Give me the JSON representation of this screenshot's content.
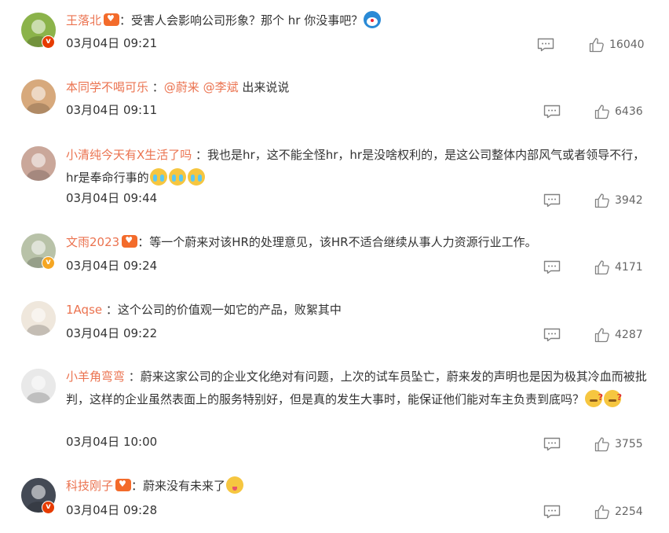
{
  "colors": {
    "username": "#eb7350",
    "text": "#333333",
    "meta": "#666666"
  },
  "comments": [
    {
      "username": "王落北",
      "badge": "red",
      "vip": true,
      "text": "：受害人会影响公司形象？那个 hr 你没事吧？",
      "emoji": [
        "doraemon"
      ],
      "time": "03月04日 09:21",
      "likes": "16040"
    },
    {
      "username": "本同学不喝可乐",
      "badge": "",
      "vip": false,
      "sep": " ：",
      "mentions": [
        "@蔚来",
        "@李斌"
      ],
      "text": " 出来说说",
      "time": "03月04日 09:11",
      "likes": "6436"
    },
    {
      "username": "小清纯今天有X生活了吗",
      "badge": "",
      "vip": false,
      "text": " ：我也是hr，这不能全怪hr，hr是没啥权利的，是这公司整体内部风气或者领导不行，hr是奉命行事的",
      "emoji": [
        "cry",
        "cry",
        "cry"
      ],
      "time": "03月04日 09:44",
      "likes": "3942"
    },
    {
      "username": "文雨2023",
      "badge": "gold",
      "vip": true,
      "text": "：等一个蔚来对该HR的处理意见，该HR不适合继续从事人力资源行业工作。",
      "time": "03月04日 09:24",
      "likes": "4171"
    },
    {
      "username": "1Aqse",
      "badge": "",
      "vip": false,
      "text": " ：这个公司的价值观一如它的产品，败絮其中",
      "time": "03月04日 09:22",
      "likes": "4287"
    },
    {
      "username": "小羊角弯弯",
      "badge": "",
      "vip": false,
      "text": " ：蔚来这家公司的企业文化绝对有问题，上次的试车员坠亡，蔚来发的声明也是因为极其冷血而被批判，这样的企业虽然表面上的服务特别好，但是真的发生大事时，能保证他们能对车主负责到底吗？",
      "emoji": [
        "think",
        "think"
      ],
      "time": "03月04日 10:00",
      "likes": "3755"
    },
    {
      "username": "科技刚子",
      "badge": "red",
      "vip": true,
      "text": "：蔚来没有未来了",
      "emoji": [
        "yum"
      ],
      "time": "03月04日 09:28",
      "likes": "2254"
    }
  ]
}
